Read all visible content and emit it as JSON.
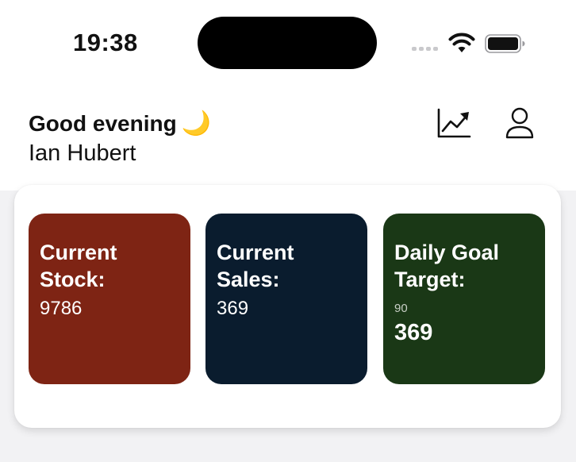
{
  "status_bar": {
    "time": "19:38",
    "icons": [
      "cellular-signal-icon",
      "wifi-icon",
      "battery-icon"
    ]
  },
  "header": {
    "greeting": "Good evening",
    "greeting_emoji": "🌙",
    "user_name": "Ian Hubert",
    "actions": [
      {
        "icon": "trending-chart-icon"
      },
      {
        "icon": "user-profile-icon"
      }
    ]
  },
  "stats": {
    "stock": {
      "label": "Current\nStock:",
      "value": "9786",
      "color": "#7e2414"
    },
    "sales": {
      "label": "Current\nSales:",
      "value": "369",
      "color": "#0a1c2e"
    },
    "goal": {
      "label": "Daily Goal\nTarget:",
      "target": "90",
      "current": "369",
      "color": "#1a3816"
    }
  }
}
